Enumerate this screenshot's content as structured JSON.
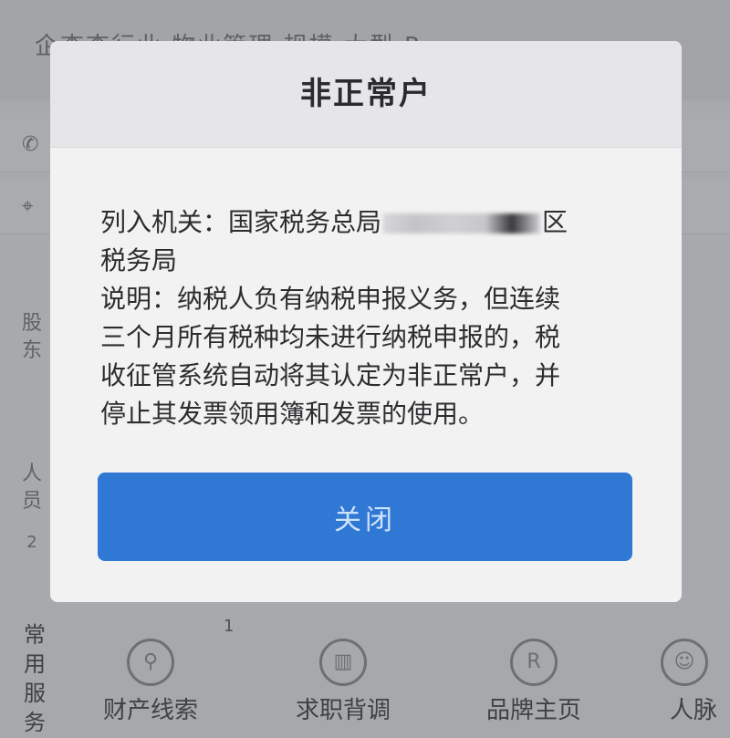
{
  "background": {
    "header_text": "企查查行业  物业管理    规模  大型  R",
    "bottom_badge": "1",
    "side_label": "常用服务",
    "side_items": [
      "股东",
      "人员",
      "2"
    ],
    "services": [
      {
        "icon": "clue-icon",
        "label": "财产线索"
      },
      {
        "icon": "job-icon",
        "label": "求职背调"
      },
      {
        "icon": "brand-icon",
        "label": "品牌主页"
      },
      {
        "icon": "person-icon",
        "label": "人脉"
      }
    ]
  },
  "dialog": {
    "title": "非正常户",
    "line1_prefix": "列入机关：国家税务总局",
    "line1_suffix": "区",
    "line2": "税务局",
    "line3": "说明：纳税人负有纳税申报义务，但连续",
    "line4": "三个月所有税种均未进行纳税申报的，税",
    "line5": "收征管系统自动将其认定为非正常户，并",
    "line6": "停止其发票领用簿和发票的使用。",
    "close_label": "关闭"
  },
  "colors": {
    "overlay": "#a7a9ad",
    "dialog_bg": "#f2f2f3",
    "title_bar": "#e6e6e8",
    "button": "#2f78d4",
    "button_text": "#cfe2fb"
  }
}
